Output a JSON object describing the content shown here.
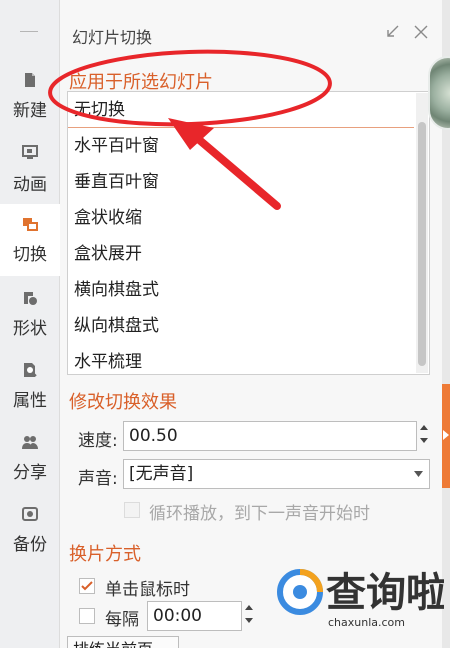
{
  "sidebar": {
    "items": [
      {
        "label": "新建",
        "icon": "new-file-icon"
      },
      {
        "label": "动画",
        "icon": "animation-icon"
      },
      {
        "label": "切换",
        "icon": "transition-icon"
      },
      {
        "label": "形状",
        "icon": "shape-icon"
      },
      {
        "label": "属性",
        "icon": "properties-icon"
      },
      {
        "label": "分享",
        "icon": "share-icon"
      },
      {
        "label": "备份",
        "icon": "backup-icon"
      }
    ],
    "active": "切换"
  },
  "panel": {
    "title": "幻灯片切换",
    "section_apply": "应用于所选幻灯片",
    "transitions": [
      "无切换",
      "水平百叶窗",
      "垂直百叶窗",
      "盒状收缩",
      "盒状展开",
      "横向棋盘式",
      "纵向棋盘式",
      "水平梳理"
    ],
    "selected_transition": "无切换",
    "section_modify": "修改切换效果",
    "speed_label": "速度:",
    "speed_value": "00.50",
    "sound_label": "声音:",
    "sound_value": "[无声音]",
    "loop_label": "循环播放，到下一声音开始时",
    "section_advance": "换片方式",
    "on_click_label": "单击鼠标时",
    "on_click_checked": true,
    "every_label": "每隔",
    "every_value": "00:00",
    "every_checked": false,
    "apply_all_label": "排练当前页"
  },
  "watermark": {
    "brand": "查询啦",
    "domain": "chaxunla.com"
  },
  "colors": {
    "accent": "#d9602a",
    "annotation": "#e8262a",
    "edge_tab": "#ee7a36"
  }
}
